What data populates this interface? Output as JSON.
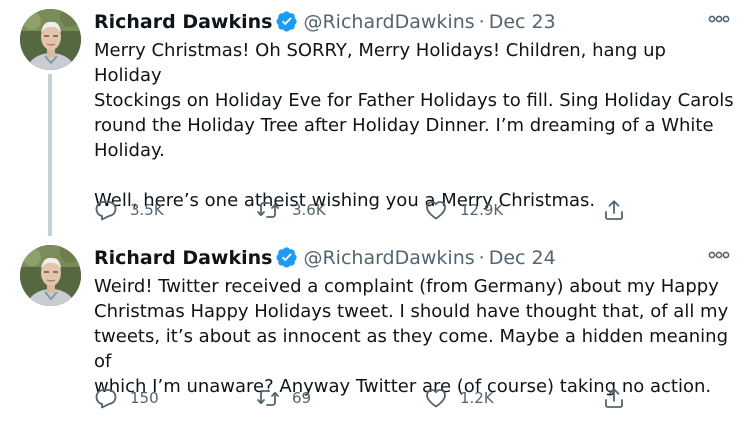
{
  "tweets": [
    {
      "author": "Richard Dawkins",
      "handle": "@RichardDawkins",
      "separator": "·",
      "date": "Dec 23",
      "text": "Merry Christmas! Oh SORRY, Merry Holidays! Children, hang up Holiday\nStockings on Holiday Eve for Father Holidays to fill. Sing Holiday Carols\nround the Holiday Tree after Holiday Dinner. I’m dreaming of a White\nHoliday.\n\nWell, here’s one atheist wishing you a Merry Christmas.",
      "replies": "3.5K",
      "retweets": "3.6K",
      "likes": "12.9K"
    },
    {
      "author": "Richard Dawkins",
      "handle": "@RichardDawkins",
      "separator": "·",
      "date": "Dec 24",
      "text": "Weird! Twitter received a complaint (from Germany) about my Happy\nChristmas Happy Holidays tweet. I should have thought that, of all my\ntweets, it’s about as innocent as they come. Maybe a hidden meaning of\nwhich I’m unaware? Anyway Twitter are (of course) taking no action.",
      "replies": "150",
      "retweets": "69",
      "likes": "1.2K"
    }
  ],
  "icons": {
    "verified": "verified-badge-icon",
    "more": "more-dots-icon",
    "reply": "reply-icon",
    "retweet": "retweet-icon",
    "like": "heart-icon",
    "share": "share-icon"
  },
  "colors": {
    "text": "#0f1419",
    "secondary": "#536471",
    "verified": "#1d9bf0",
    "thread_line": "#c4cfd6"
  }
}
